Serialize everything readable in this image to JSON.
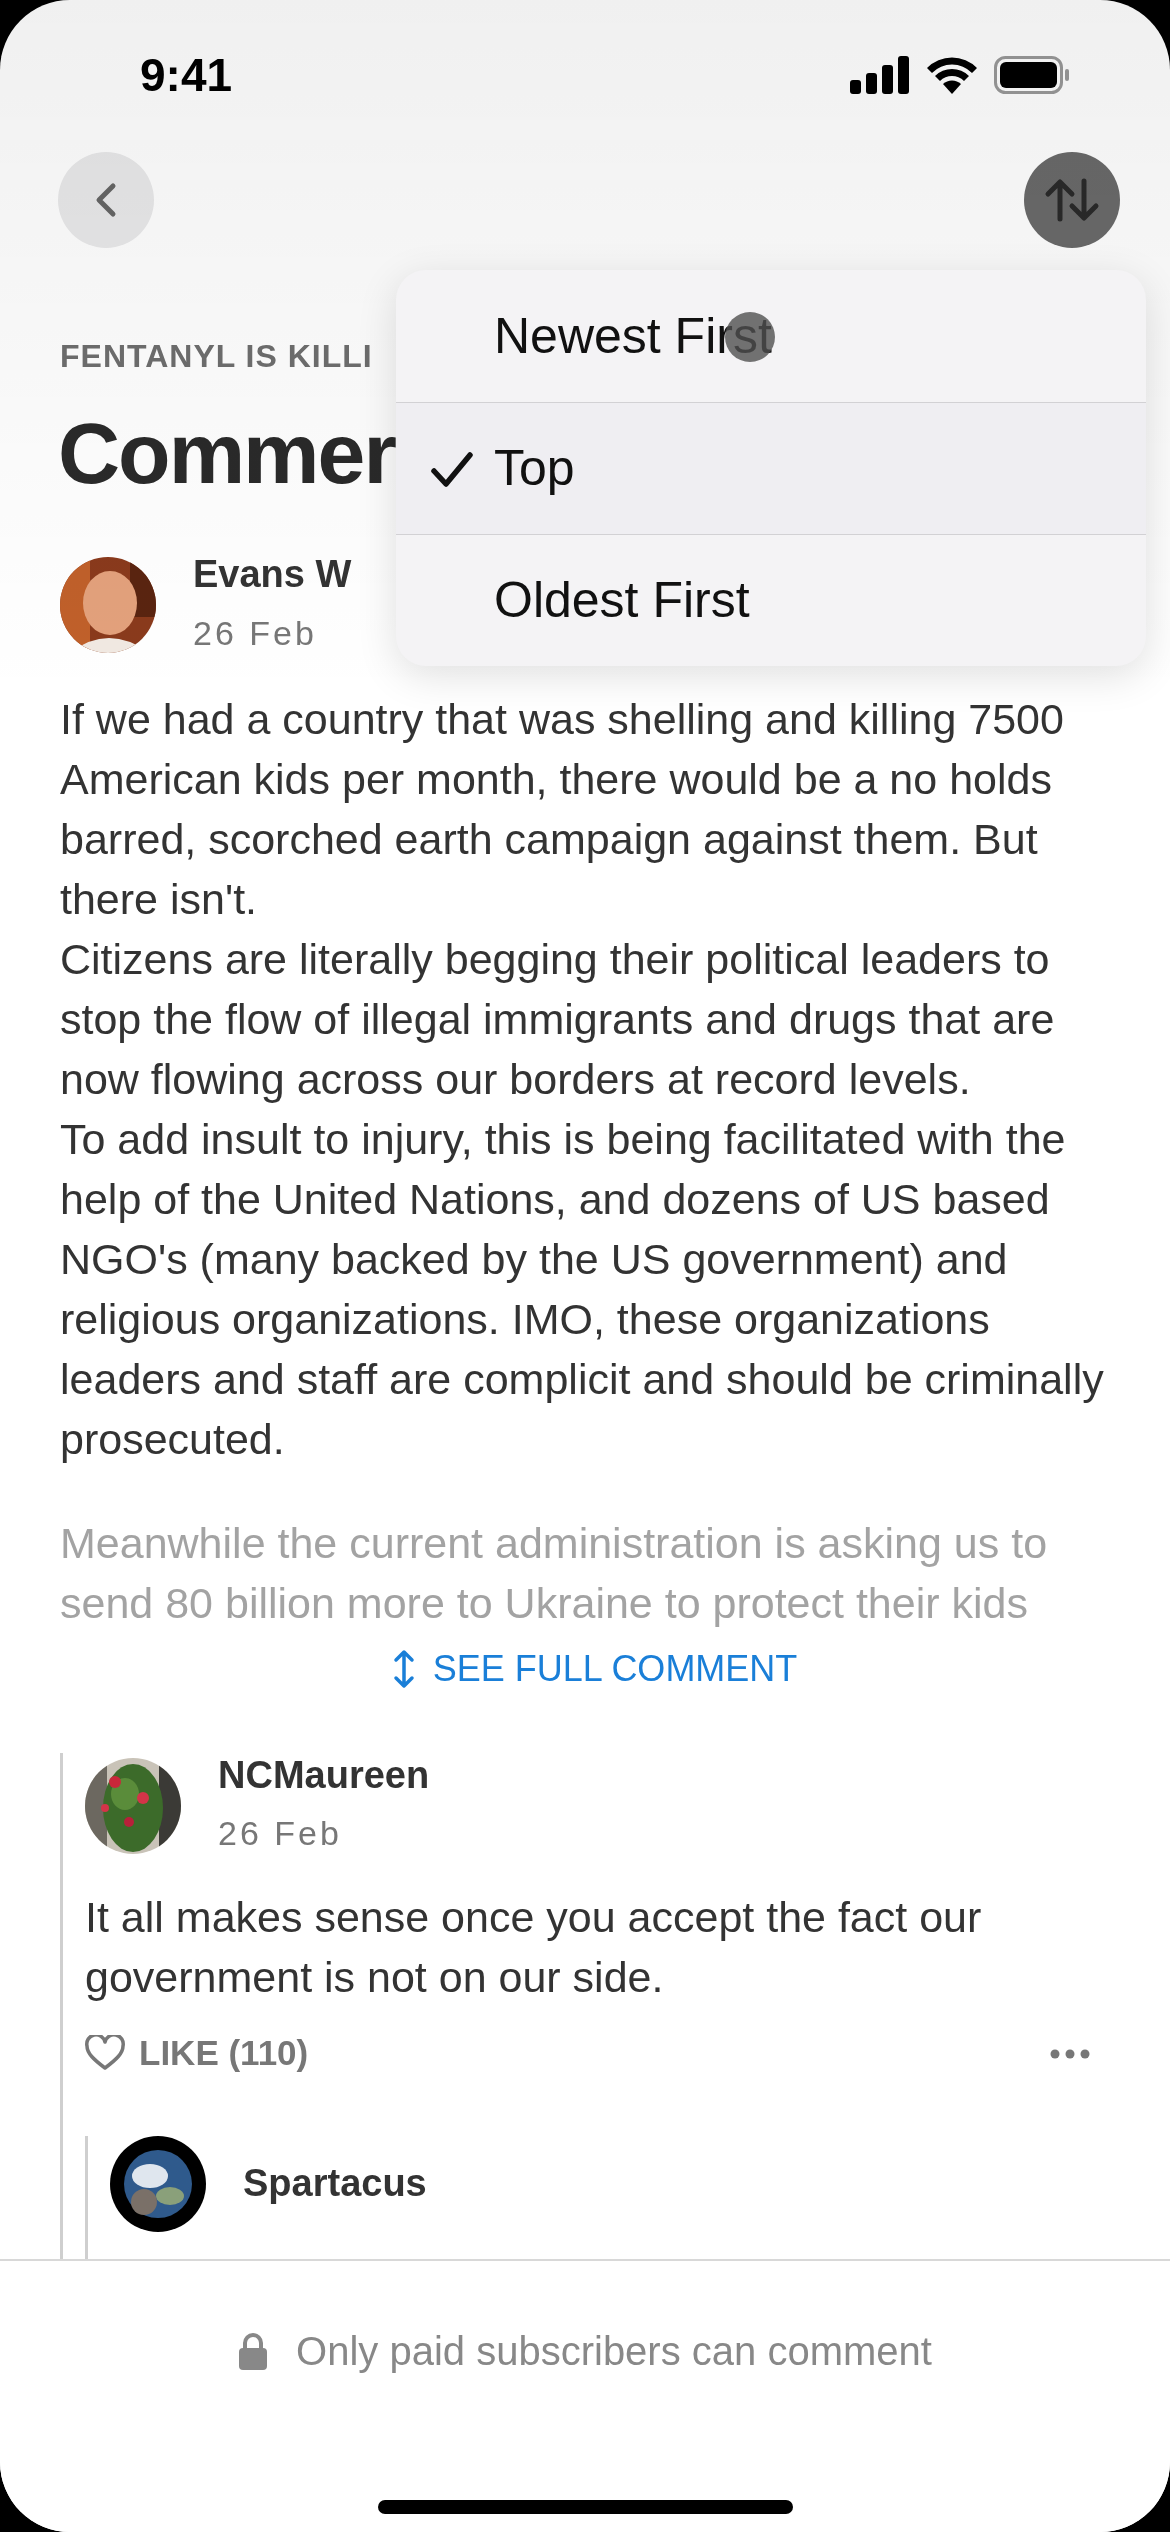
{
  "status_bar": {
    "time": "9:41"
  },
  "header": {
    "kicker": "FENTANYL IS KILLI",
    "title": "Commer"
  },
  "sort_menu": {
    "options": [
      {
        "label": "Newest First",
        "selected": false
      },
      {
        "label": "Top",
        "selected": true
      },
      {
        "label": "Oldest First",
        "selected": false
      }
    ]
  },
  "comments": [
    {
      "author": "Evans W",
      "date": "26 Feb",
      "paragraphs": [
        "If we had a country that was shelling and killing 7500 American kids per month, there would be a no holds barred, scorched earth campaign against them.  But there isn't.",
        "Citizens are literally begging their political leaders to stop the flow of illegal immigrants and drugs that are now flowing across our borders at record levels.",
        "To add insult to injury, this is being facilitated with the help of the United Nations, and dozens of US based NGO's (many backed by the US government) and religious organizations.  IMO, these organizations leaders and staff are complicit and should be criminally prosecuted."
      ],
      "faded_text": "Meanwhile the current administration is asking us to send 80 billion more to Ukraine to protect their kids",
      "expand_link": "SEE FULL COMMENT",
      "replies": [
        {
          "author": "NCMaureen",
          "date": "26 Feb",
          "paragraphs": [
            "It all makes sense once you accept the fact our government is not on our side."
          ],
          "like": "LIKE (110)",
          "replies": [
            {
              "author": "Spartacus"
            }
          ]
        }
      ]
    }
  ],
  "footer": {
    "notice": "Only paid subscribers can comment"
  }
}
